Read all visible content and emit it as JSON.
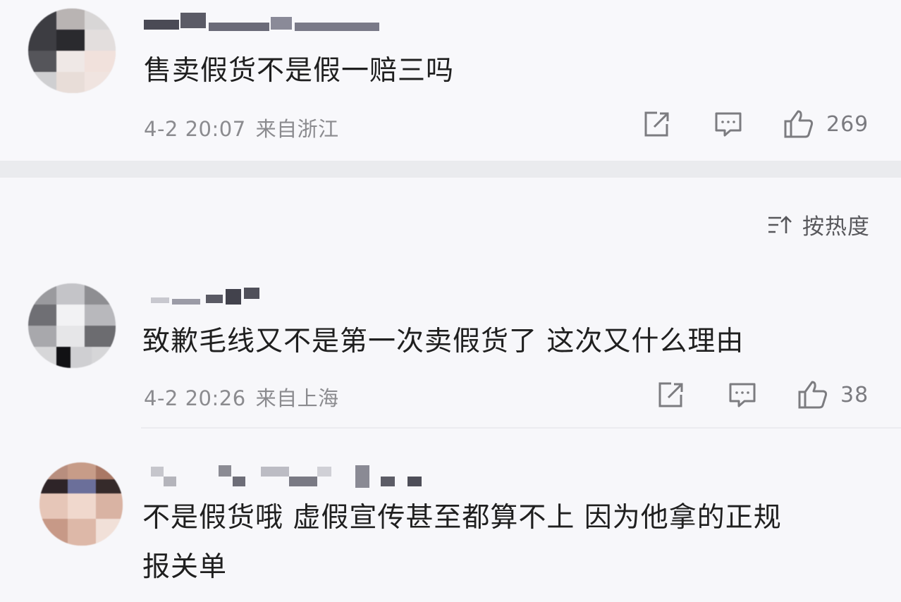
{
  "sort": {
    "icon": "sort-icon",
    "label": "按热度"
  },
  "comments": [
    {
      "text": "售卖假货不是假一赔三吗",
      "date": "4-2 20:07",
      "location": "来自浙江",
      "likes": "269"
    },
    {
      "text": "致歉毛线又不是第一次卖假货了 这次又什么理由",
      "date": "4-2 20:26",
      "location": "来自上海",
      "likes": "38"
    },
    {
      "text_line1": "不是假货哦 虚假宣传甚至都算不上 因为他拿的正规",
      "text_line2": "报关单"
    }
  ],
  "icons": {
    "share": "share-icon",
    "reply": "comment-icon",
    "like": "thumbs-up-icon"
  },
  "colors": {
    "background": "#f7f7fa",
    "divider": "#eaebee",
    "text": "#1f1f1f",
    "meta": "#8b8b8f"
  }
}
